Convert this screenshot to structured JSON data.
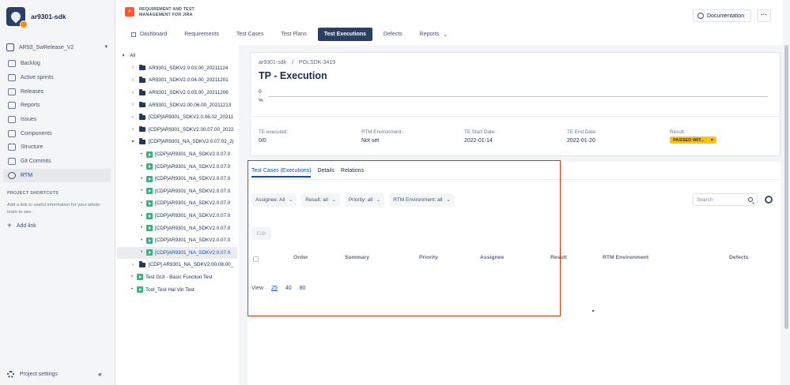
{
  "project": {
    "name": "ar9301-sdk",
    "board": "AR93_SwRelease_V2"
  },
  "sidebar": {
    "items": [
      {
        "label": "Backlog",
        "icon": "backlog-icon"
      },
      {
        "label": "Active sprints",
        "icon": "sprint-icon"
      },
      {
        "label": "Releases",
        "icon": "releases-icon"
      },
      {
        "label": "Reports",
        "icon": "reports-icon"
      },
      {
        "label": "Issues",
        "icon": "issues-icon"
      },
      {
        "label": "Components",
        "icon": "components-icon"
      },
      {
        "label": "Structure",
        "icon": "structure-icon"
      },
      {
        "label": "Git Commits",
        "icon": "git-icon"
      },
      {
        "label": "RTM",
        "icon": "rtm-icon",
        "active": true
      }
    ],
    "shortcuts_title": "PROJECT SHORTCUTS",
    "shortcuts_desc": "Add a link to useful information for your whole team to see.",
    "add_link": "Add link",
    "settings": "Project settings",
    "collapse": "«"
  },
  "app": {
    "title_line1": "REQUIREMENT AND TEST",
    "title_line2": "MANAGEMENT FOR JIRA",
    "documentation": "Documentation",
    "more": "···"
  },
  "tabs": [
    {
      "label": "Dashboard",
      "icon": true
    },
    {
      "label": "Requirements"
    },
    {
      "label": "Test Cases"
    },
    {
      "label": "Test Plans"
    },
    {
      "label": "Test Executions",
      "active": true
    },
    {
      "label": "Defects"
    },
    {
      "label": "Reports",
      "dropdown": true
    }
  ],
  "tree": [
    {
      "label": "All",
      "level": 0,
      "type": "caret-down"
    },
    {
      "label": "AR9301_SDKV2.0.03.00_20211124",
      "level": 1,
      "type": "folder"
    },
    {
      "label": "AR9301_SDKV2.0.04.00_20211201",
      "level": 1,
      "type": "folder"
    },
    {
      "label": "AR9301_SDKV2.0.05.00_20211206",
      "level": 1,
      "type": "folder"
    },
    {
      "label": "AR9301_SDKV2.00.06.00_20211213",
      "level": 1,
      "type": "folder"
    },
    {
      "label": "[CDP]AR9301_SDKV2.0.06.02_20211",
      "level": 1,
      "type": "folder"
    },
    {
      "label": "[CDP]AR9301_SDKV2.00.07.00_2022",
      "level": 1,
      "type": "folder"
    },
    {
      "label": "[CDP]AR9301_NA_SDKV2.0.07.02_2(",
      "level": 1,
      "type": "folder-open"
    },
    {
      "label": "[CDP]AR9301_NA_SDKV2.0.07.0",
      "level": 2,
      "type": "exec"
    },
    {
      "label": "[CDP]AR9301_NA_SDKV2.0.07.0",
      "level": 2,
      "type": "exec"
    },
    {
      "label": "[CDP]AR9301_NA_SDKV2.0.07.0",
      "level": 2,
      "type": "exec"
    },
    {
      "label": "[CDP]AR9301_NA_SDKV2.0.07.0",
      "level": 2,
      "type": "exec"
    },
    {
      "label": "[CDP]AR9301_NA_SDKV2.0.07.0",
      "level": 2,
      "type": "exec"
    },
    {
      "label": "[CDP]AR9301_NA_SDKV2.0.07.0",
      "level": 2,
      "type": "exec"
    },
    {
      "label": "[CDP]AR9301_NA_SDKV2.0.07.0",
      "level": 2,
      "type": "exec"
    },
    {
      "label": "[CDP]AR9301_NA_SDKV2.0.07.0",
      "level": 2,
      "type": "exec"
    },
    {
      "label": "[CDP]AR9301_NA_SDKV2.0.07.0",
      "level": 2,
      "type": "exec",
      "selected": true
    },
    {
      "label": "[CDP] AR9301_NA_SDKV2.00.08.00_",
      "level": 1,
      "type": "folder"
    },
    {
      "label": "Test GUI - Basic Function Test",
      "level": 1,
      "type": "exec-bullet"
    },
    {
      "label": "Tool_Test Hal Vin Test",
      "level": 1,
      "type": "exec-bullet"
    }
  ],
  "execution": {
    "breadcrumb_project": "ar9301-sdk",
    "breadcrumb_sep": "/",
    "breadcrumb_key": "POLSDK-3419",
    "title": "TP - Execution",
    "progress_count": "0",
    "progress_pct": "%",
    "progress_fraction": 0,
    "te_executed_label": "TE executed:",
    "te_executed_value": "0/0",
    "env_label": "RTM Environment:",
    "env_value": "Not set",
    "start_label": "TE Start Date:",
    "start_value": "2022-01-14",
    "end_label": "TE End Date:",
    "end_value": "2022-01-20",
    "result_label": "Result:",
    "result_value": "PASSED WIT...",
    "result_color": "#ffc400"
  },
  "details": {
    "tabs": [
      "Test Cases (Executions)",
      "Details",
      "Relations"
    ],
    "filters": [
      "Assignee: All",
      "Result: all",
      "Priority: all",
      "RTM Environment: all"
    ],
    "search_placeholder": "Search",
    "edit_label": "Edit",
    "columns": [
      "Order",
      "Summary",
      "Priority",
      "Assignee",
      "Result",
      "RTM Environment",
      "Defects"
    ],
    "view_label": "View",
    "page_sizes": [
      "25",
      "40",
      "80"
    ],
    "current_page_size": "25"
  },
  "colors": {
    "nav_active_bg": "#2c3e66",
    "link": "#0052cc",
    "highlight_box": "#de350b",
    "exec_icon": "#36b37e"
  }
}
